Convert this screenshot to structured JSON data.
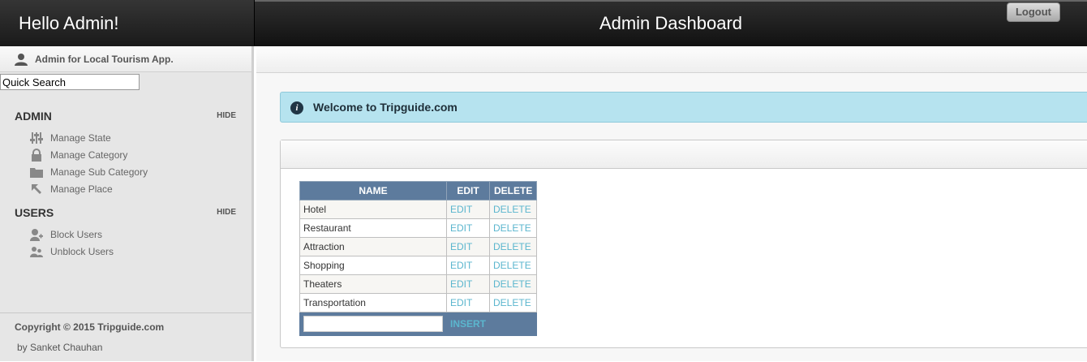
{
  "header": {
    "greeting": "Hello Admin!",
    "title": "Admin Dashboard",
    "logout_label": "Logout"
  },
  "sidebar": {
    "user_label": "Admin for Local Tourism App.",
    "search_value": "Quick Search",
    "sections": [
      {
        "title": "ADMIN",
        "hide_label": "HIDE",
        "items": [
          {
            "label": "Manage State",
            "icon": "sliders-icon"
          },
          {
            "label": "Manage Category",
            "icon": "lock-icon"
          },
          {
            "label": "Manage Sub Category",
            "icon": "folder-icon"
          },
          {
            "label": "Manage Place",
            "icon": "cursor-arrow-icon"
          }
        ]
      },
      {
        "title": "USERS",
        "hide_label": "HIDE",
        "items": [
          {
            "label": "Block Users",
            "icon": "user-add-icon"
          },
          {
            "label": "Unblock Users",
            "icon": "users-icon"
          }
        ]
      }
    ],
    "footer": {
      "copyright": "Copyright © 2015 Tripguide.com",
      "author": "by Sanket Chauhan"
    }
  },
  "main": {
    "info_message": "Welcome to Tripguide.com",
    "table": {
      "columns": [
        "NAME",
        "EDIT",
        "DELETE"
      ],
      "rows": [
        {
          "name": "Hotel",
          "edit": "EDIT",
          "delete": "DELETE"
        },
        {
          "name": "Restaurant",
          "edit": "EDIT",
          "delete": "DELETE"
        },
        {
          "name": "Attraction",
          "edit": "EDIT",
          "delete": "DELETE"
        },
        {
          "name": "Shopping",
          "edit": "EDIT",
          "delete": "DELETE"
        },
        {
          "name": "Theaters",
          "edit": "EDIT",
          "delete": "DELETE"
        },
        {
          "name": "Transportation",
          "edit": "EDIT",
          "delete": "DELETE"
        }
      ],
      "insert_value": "",
      "insert_label": "INSERT"
    }
  },
  "colors": {
    "header_bg": "#1a1a1a",
    "grid_header": "#5d7b9d",
    "link": "#5bb6ce",
    "info_bg": "#b6e3ef"
  }
}
